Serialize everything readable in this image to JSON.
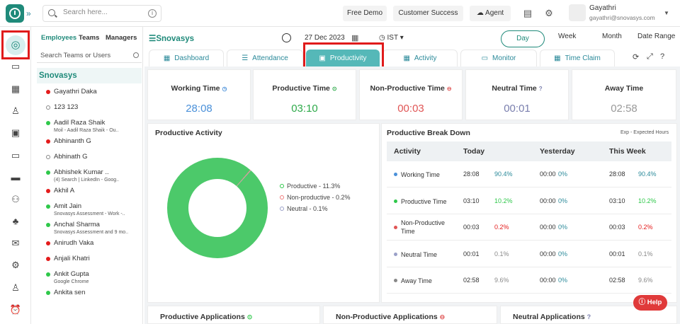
{
  "topbar": {
    "search_placeholder": "Search here...",
    "free_demo": "Free Demo",
    "customer_success": "Customer Success",
    "agent": "Agent",
    "user_name": "Gayathri",
    "user_email": "gayathri@snovasys.com"
  },
  "panel": {
    "tabs": [
      "Employees",
      "Teams",
      "Managers"
    ],
    "search_placeholder": "Search Teams or Users",
    "org": "Snovasys",
    "employees": [
      {
        "name": "Gayathri Daka",
        "sub": "",
        "status": "red"
      },
      {
        "name": "123 123",
        "sub": "",
        "status": "grey"
      },
      {
        "name": "Aadil Raza Shaik",
        "sub": "Moil - Aadil Raza Shaik - Ou..",
        "status": "green"
      },
      {
        "name": "Abhinanth G",
        "sub": "",
        "status": "red"
      },
      {
        "name": "Abhinath G",
        "sub": "",
        "status": "grey"
      },
      {
        "name": "Abhishek Kumar ..",
        "sub": "(4) Search | LinkedIn - Goog..",
        "status": "green"
      },
      {
        "name": "Akhil A",
        "sub": "",
        "status": "red"
      },
      {
        "name": "Amit Jain",
        "sub": "Snovasys Assessment - Work -..",
        "status": "green"
      },
      {
        "name": "Anchal Sharma",
        "sub": "Snovasys Assessment and 9 mo..",
        "status": "green"
      },
      {
        "name": "Anirudh Vaka",
        "sub": "",
        "status": "red"
      },
      {
        "name": "Anjali Khatri",
        "sub": "",
        "status": "red"
      },
      {
        "name": "Ankit Gupta",
        "sub": "Google Chrome",
        "status": "green"
      },
      {
        "name": "Ankita sen",
        "sub": "",
        "status": "green"
      }
    ]
  },
  "header": {
    "org": "Snovasys",
    "date": "27 Dec 2023",
    "tz": "IST",
    "periods": [
      "Day",
      "Week",
      "Month",
      "Date Range"
    ]
  },
  "tabs": [
    "Dashboard",
    "Attendance",
    "Productivity",
    "Activity",
    "Monitor",
    "Time Claim"
  ],
  "metrics": [
    {
      "label": "Working Time",
      "value": "28:08",
      "color": "#4a90d9"
    },
    {
      "label": "Productive Time",
      "value": "03:10",
      "color": "#2eaa4a"
    },
    {
      "label": "Non-Productive Time",
      "value": "00:03",
      "color": "#e05555"
    },
    {
      "label": "Neutral Time",
      "value": "00:01",
      "color": "#7a7fae"
    },
    {
      "label": "Away Time",
      "value": "02:58",
      "color": "#999999"
    }
  ],
  "productive_activity": {
    "title": "Productive Activity",
    "legend": [
      "Productive - 11.3%",
      "Non-productive - 0.2%",
      "Neutral - 0.1%"
    ]
  },
  "chart_data": {
    "type": "pie",
    "title": "Productive Activity",
    "categories": [
      "Productive",
      "Non-productive",
      "Neutral",
      "Away"
    ],
    "values": [
      11.3,
      0.2,
      0.1,
      88.4
    ],
    "colors": [
      "#4cc96a",
      "#f07b7b",
      "#9aa0c8",
      "#4cc96a"
    ]
  },
  "breakdown": {
    "title": "Productive Break Down",
    "note": "Exp - Expected Hours",
    "headers": [
      "Activity",
      "Today",
      "Yesterday",
      "This Week"
    ],
    "rows": [
      {
        "activity": "Working Time",
        "today": "28:08",
        "today_pct": "90.4%",
        "yest": "00:00",
        "yest_pct": "0%",
        "week": "28:08",
        "week_pct": "90.4%",
        "dot": "#4a90d9",
        "pct_class": ""
      },
      {
        "activity": "Productive Time",
        "today": "03:10",
        "today_pct": "10.2%",
        "yest": "00:00",
        "yest_pct": "0%",
        "week": "03:10",
        "week_pct": "10.2%",
        "dot": "#2ec84a",
        "pct_class": "green"
      },
      {
        "activity": "Non-Productive Time",
        "today": "00:03",
        "today_pct": "0.2%",
        "yest": "00:00",
        "yest_pct": "0%",
        "week": "00:03",
        "week_pct": "0.2%",
        "dot": "#e05555",
        "pct_class": "red"
      },
      {
        "activity": "Neutral Time",
        "today": "00:01",
        "today_pct": "0.1%",
        "yest": "00:00",
        "yest_pct": "0%",
        "week": "00:01",
        "week_pct": "0.1%",
        "dot": "#9aa0c8",
        "pct_class": "grey"
      },
      {
        "activity": "Away Time",
        "today": "02:58",
        "today_pct": "9.6%",
        "yest": "00:00",
        "yest_pct": "0%",
        "week": "02:58",
        "week_pct": "9.6%",
        "dot": "#888888",
        "pct_class": "grey"
      }
    ]
  },
  "bottom": [
    "Productive Applications",
    "Non-Productive Applications",
    "Neutral Applications"
  ],
  "help": "Help"
}
